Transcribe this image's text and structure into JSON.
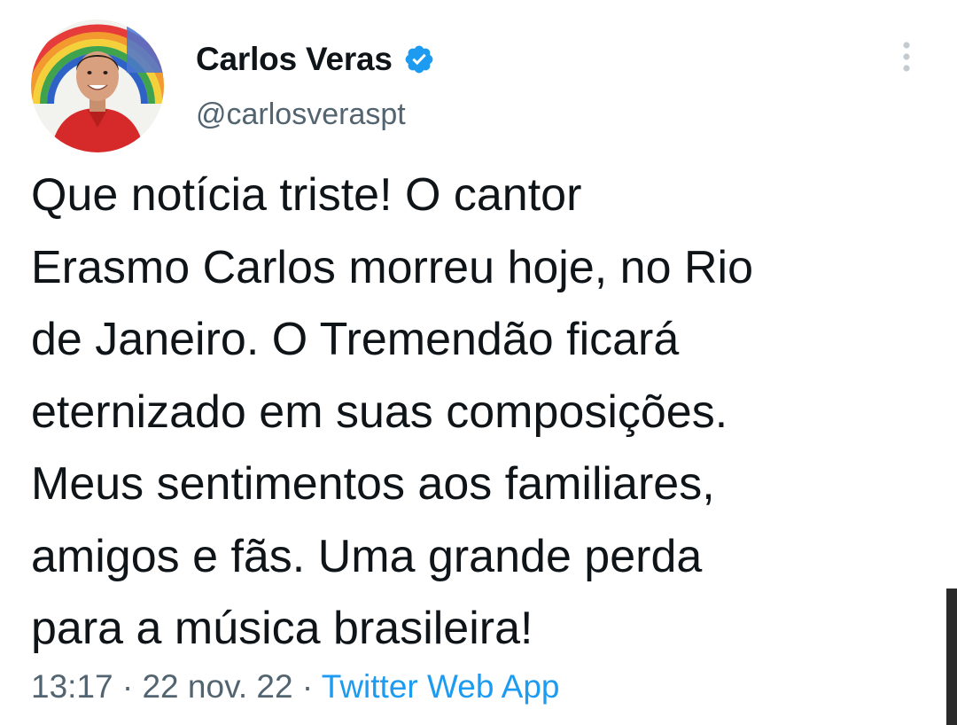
{
  "tweet": {
    "author": {
      "display_name": "Carlos Veras",
      "handle": "@carlosveraspt",
      "verified": true,
      "verified_icon": "verified-badge-icon",
      "avatar_icon": "profile-photo"
    },
    "more_icon": "more-vertical-icon",
    "text_lines": [
      "Que notícia triste! O cantor",
      "Erasmo Carlos morreu hoje, no Rio",
      "de Janeiro. O Tremendão ficará",
      "eternizado em suas composições.",
      "Meus sentimentos aos familiares,",
      "amigos e fãs. Uma grande perda",
      "para a música brasileira!"
    ],
    "time": "13:17",
    "date": "22 nov. 22",
    "separator": "·",
    "source": "Twitter Web App"
  },
  "colors": {
    "text": "#0f1419",
    "secondary": "#536471",
    "link": "#1d9bf0",
    "verified": "#1d9bf0"
  }
}
